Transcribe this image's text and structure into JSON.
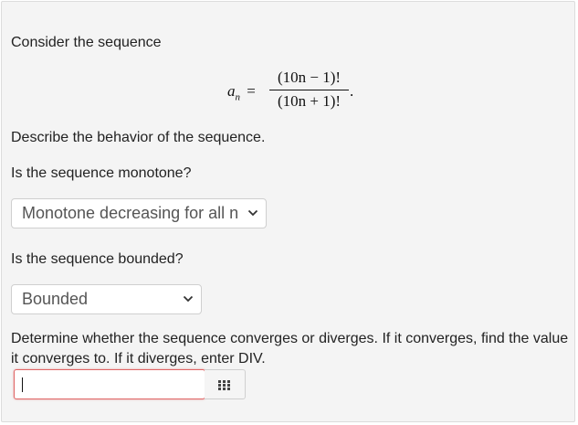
{
  "intro": "Consider the sequence",
  "formula": {
    "lhs_var": "a",
    "lhs_sub": "n",
    "equals": "=",
    "numerator": "(10n − 1)!",
    "denominator": "(10n + 1)!",
    "period": "."
  },
  "prompt_describe": "Describe the behavior of the sequence.",
  "q_monotone": {
    "label": "Is the sequence monotone?",
    "selected": "Monotone decreasing for all n"
  },
  "q_bounded": {
    "label": "Is the sequence bounded?",
    "selected": "Bounded"
  },
  "q_converge": {
    "label_line1": "Determine whether the sequence converges or diverges. If it converges, find the value",
    "label_line2": "it converges to. If it diverges, enter DIV.",
    "input_value": ""
  },
  "icons": {
    "select_arrow": "chevron-down-icon",
    "keypad": "keypad-grid-icon"
  },
  "colors": {
    "panel_bg": "#f4f4f4",
    "input_error_border": "#e06666"
  }
}
